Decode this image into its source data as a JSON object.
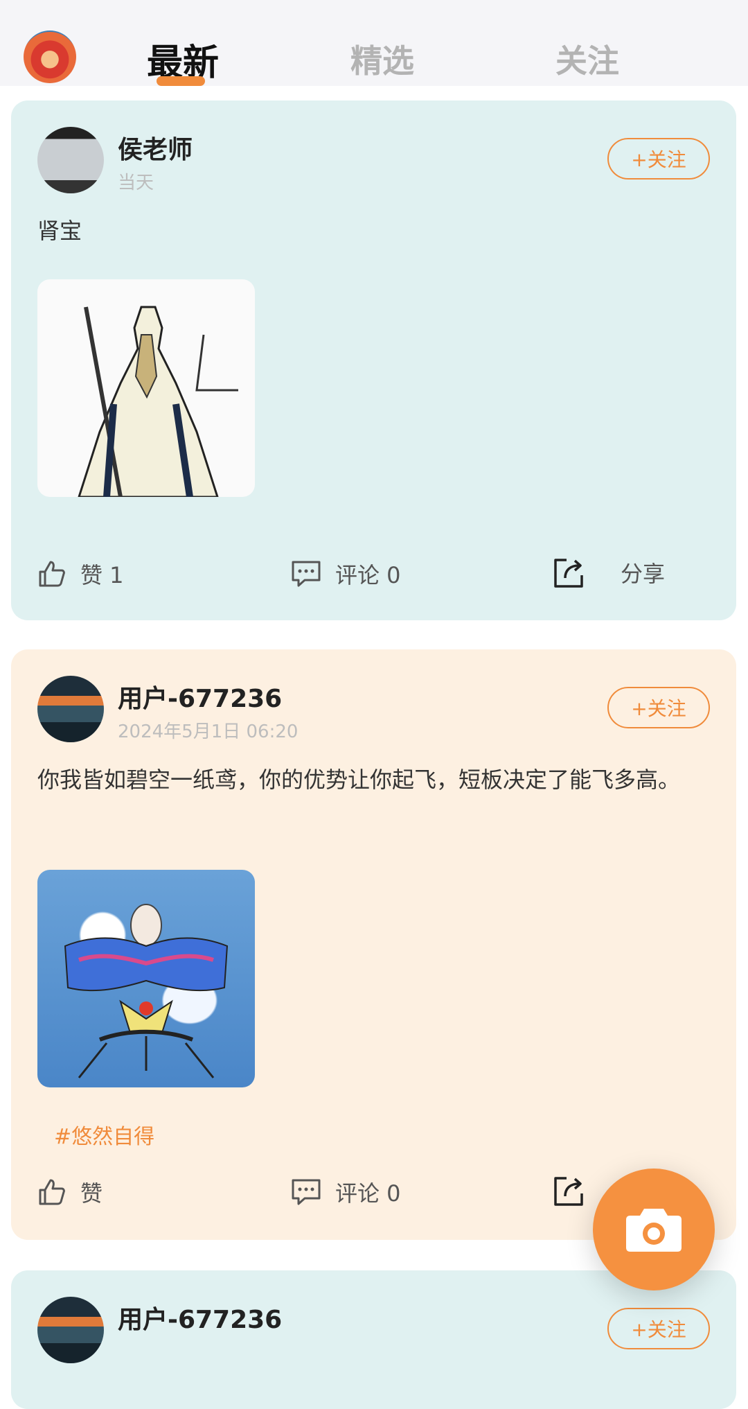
{
  "tabs": [
    {
      "label": "最新",
      "active": true
    },
    {
      "label": "精选",
      "active": false
    },
    {
      "label": "关注",
      "active": false
    }
  ],
  "posts": [
    {
      "author": "侯老师",
      "time": "当天",
      "follow_label": "+关注",
      "text": "肾宝",
      "like_label": "赞 1",
      "comment_label": "评论 0",
      "share_label": "分享"
    },
    {
      "author": "用户-677236",
      "time": "2024年5月1日 06:20",
      "follow_label": "+关注",
      "text": "你我皆如碧空一纸鸢，你的优势让你起飞，短板决定了能飞多高。",
      "tag": "#悠然自得",
      "like_label": "赞",
      "comment_label": "评论 0"
    },
    {
      "author": "用户-677236",
      "follow_label": "+关注"
    }
  ],
  "colors": {
    "accent": "#f08b3b",
    "card_teal": "#e0f1f1",
    "card_cream": "#fdf0e1"
  },
  "icons": [
    "like-icon",
    "comment-icon",
    "share-icon",
    "camera-icon"
  ]
}
